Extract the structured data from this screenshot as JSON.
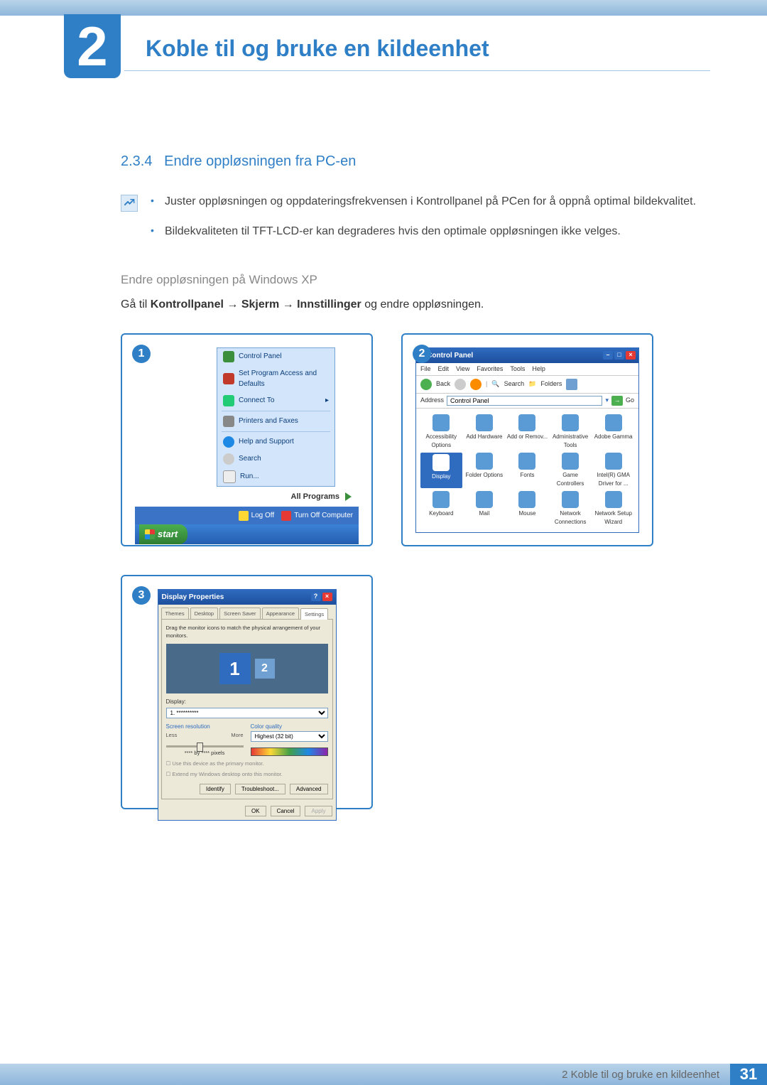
{
  "chapter_number": "2",
  "chapter_title": "Koble til og bruke en kildeenhet",
  "section": {
    "number": "2.3.4",
    "title": "Endre oppløsningen fra PC-en"
  },
  "notes": [
    "Juster oppløsningen og oppdateringsfrekvensen i Kontrollpanel på PCen for å oppnå optimal bildekvalitet.",
    "Bildekvaliteten til TFT-LCD-er kan degraderes hvis den optimale oppløsningen ikke velges."
  ],
  "sub_heading": "Endre oppløsningen på Windows XP",
  "instruction": {
    "prefix": "Gå til ",
    "path1": "Kontrollpanel",
    "arrow": " → ",
    "path2": "Skjerm",
    "path3": "Innstillinger",
    "suffix": " og endre oppløsningen."
  },
  "panel1": {
    "num": "1",
    "items": {
      "control_panel": "Control Panel",
      "set_program": "Set Program Access and Defaults",
      "connect_to": "Connect To",
      "printers": "Printers and Faxes",
      "help": "Help and Support",
      "search": "Search",
      "run": "Run..."
    },
    "all_programs": "All Programs",
    "logoff": "Log Off",
    "turnoff": "Turn Off Computer",
    "start": "start"
  },
  "panel2": {
    "num": "2",
    "title": "Control Panel",
    "menu": [
      "File",
      "Edit",
      "View",
      "Favorites",
      "Tools",
      "Help"
    ],
    "toolbar": {
      "back": "Back",
      "search": "Search",
      "folders": "Folders"
    },
    "address_label": "Address",
    "address_value": "Control Panel",
    "go": "Go",
    "items": [
      "Accessibility Options",
      "Add Hardware",
      "Add or Remov...",
      "Administrative Tools",
      "Adobe Gamma",
      "Display",
      "Folder Options",
      "Fonts",
      "Game Controllers",
      "Intel(R) GMA Driver for ...",
      "Keyboard",
      "Mail",
      "Mouse",
      "Network Connections",
      "Network Setup Wizard"
    ],
    "highlight_index": 5
  },
  "panel3": {
    "num": "3",
    "title": "Display Properties",
    "tabs": [
      "Themes",
      "Desktop",
      "Screen Saver",
      "Appearance",
      "Settings"
    ],
    "active_tab": 4,
    "instruction": "Drag the monitor icons to match the physical arrangement of your monitors.",
    "mon1": "1",
    "mon2": "2",
    "display_label": "Display:",
    "display_value": "1. **********",
    "screen_res_label": "Screen resolution",
    "less": "Less",
    "more": "More",
    "pixels": "**** by **** pixels",
    "color_label": "Color quality",
    "color_value": "Highest (32 bit)",
    "chk1": "Use this device as the primary monitor.",
    "chk2": "Extend my Windows desktop onto this monitor.",
    "btn_identify": "Identify",
    "btn_troubleshoot": "Troubleshoot...",
    "btn_advanced": "Advanced",
    "btn_ok": "OK",
    "btn_cancel": "Cancel",
    "btn_apply": "Apply"
  },
  "footer": {
    "text": "2 Koble til og bruke en kildeenhet",
    "page": "31"
  }
}
